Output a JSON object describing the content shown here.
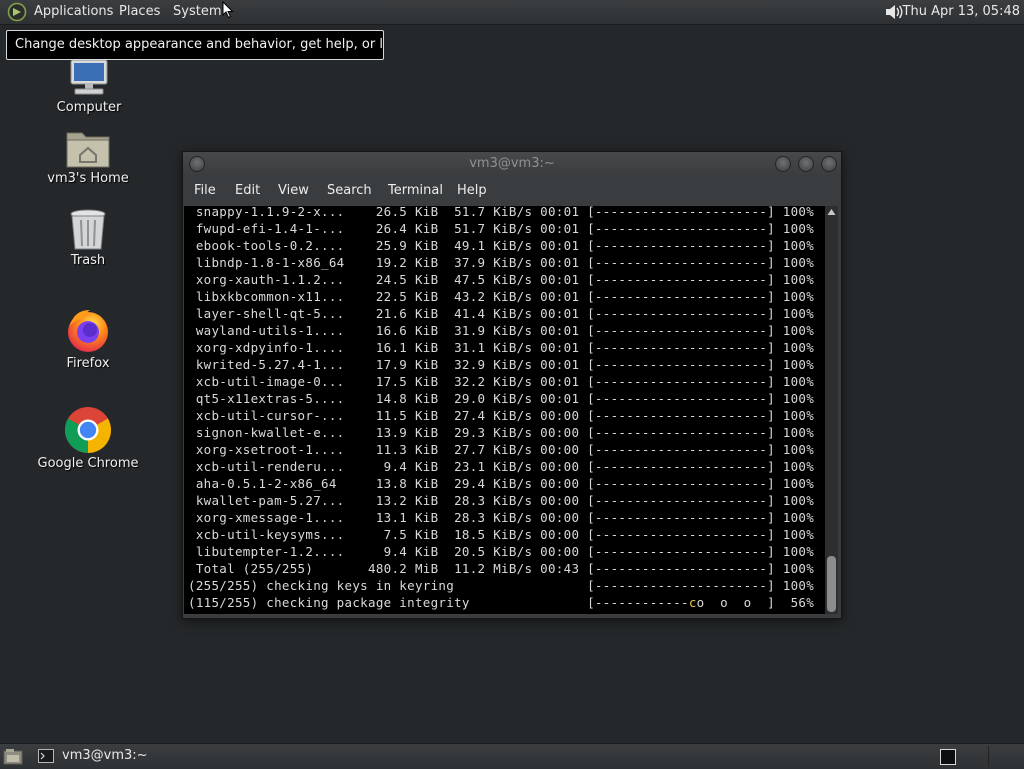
{
  "top_panel": {
    "menus": [
      "Applications",
      "Places",
      "System"
    ],
    "clock": "Thu Apr 13, 05:48"
  },
  "tooltip": "Change desktop appearance and behavior, get help, or log out",
  "desktop_icons": [
    {
      "label": "Computer",
      "icon": "computer-icon"
    },
    {
      "label": "vm3's Home",
      "icon": "home-folder-icon"
    },
    {
      "label": "Trash",
      "icon": "trash-icon"
    },
    {
      "label": "Firefox",
      "icon": "firefox-icon"
    },
    {
      "label": "Google Chrome",
      "icon": "chrome-icon"
    }
  ],
  "terminal": {
    "title": "vm3@vm3:~",
    "menu": [
      "File",
      "Edit",
      "View",
      "Search",
      "Terminal",
      "Help"
    ],
    "lines": [
      " snappy-1.1.9-2-x...    26.5 KiB  51.7 KiB/s 00:01 [----------------------] 100%",
      " fwupd-efi-1.4-1-...    26.4 KiB  51.7 KiB/s 00:01 [----------------------] 100%",
      " ebook-tools-0.2....    25.9 KiB  49.1 KiB/s 00:01 [----------------------] 100%",
      " libndp-1.8-1-x86_64    19.2 KiB  37.9 KiB/s 00:01 [----------------------] 100%",
      " xorg-xauth-1.1.2...    24.5 KiB  47.5 KiB/s 00:01 [----------------------] 100%",
      " libxkbcommon-x11...    22.5 KiB  43.2 KiB/s 00:01 [----------------------] 100%",
      " layer-shell-qt-5...    21.6 KiB  41.4 KiB/s 00:01 [----------------------] 100%",
      " wayland-utils-1....    16.6 KiB  31.9 KiB/s 00:01 [----------------------] 100%",
      " xorg-xdpyinfo-1....    16.1 KiB  31.1 KiB/s 00:01 [----------------------] 100%",
      " kwrited-5.27.4-1...    17.9 KiB  32.9 KiB/s 00:01 [----------------------] 100%",
      " xcb-util-image-0...    17.5 KiB  32.2 KiB/s 00:01 [----------------------] 100%",
      " qt5-x11extras-5....    14.8 KiB  29.0 KiB/s 00:01 [----------------------] 100%",
      " xcb-util-cursor-...    11.5 KiB  27.4 KiB/s 00:00 [----------------------] 100%",
      " signon-kwallet-e...    13.9 KiB  29.3 KiB/s 00:00 [----------------------] 100%",
      " xorg-xsetroot-1....    11.3 KiB  27.7 KiB/s 00:00 [----------------------] 100%",
      " xcb-util-renderu...     9.4 KiB  23.1 KiB/s 00:00 [----------------------] 100%",
      " aha-0.5.1-2-x86_64     13.8 KiB  29.4 KiB/s 00:00 [----------------------] 100%",
      " kwallet-pam-5.27...    13.2 KiB  28.3 KiB/s 00:00 [----------------------] 100%",
      " xorg-xmessage-1....    13.1 KiB  28.3 KiB/s 00:00 [----------------------] 100%",
      " xcb-util-keysyms...     7.5 KiB  18.5 KiB/s 00:00 [----------------------] 100%",
      " libutempter-1.2....     9.4 KiB  20.5 KiB/s 00:00 [----------------------] 100%",
      " Total (255/255)       480.2 MiB  11.2 MiB/s 00:43 [----------------------] 100%",
      "(255/255) checking keys in keyring                 [----------------------] 100%"
    ],
    "progress_line": {
      "prefix": "(115/255) checking package integrity               [------------",
      "pacman": "c",
      "suffix": "o  o  o  ]  56%"
    }
  },
  "taskbar": {
    "window_button": "vm3@vm3:~"
  },
  "colors": {
    "desktop_bg": "#25282a",
    "panel_bg": "#34373a",
    "terminal_bg": "#000000",
    "terminal_fg": "#d9d9d9",
    "pacman": "#e7c547"
  }
}
